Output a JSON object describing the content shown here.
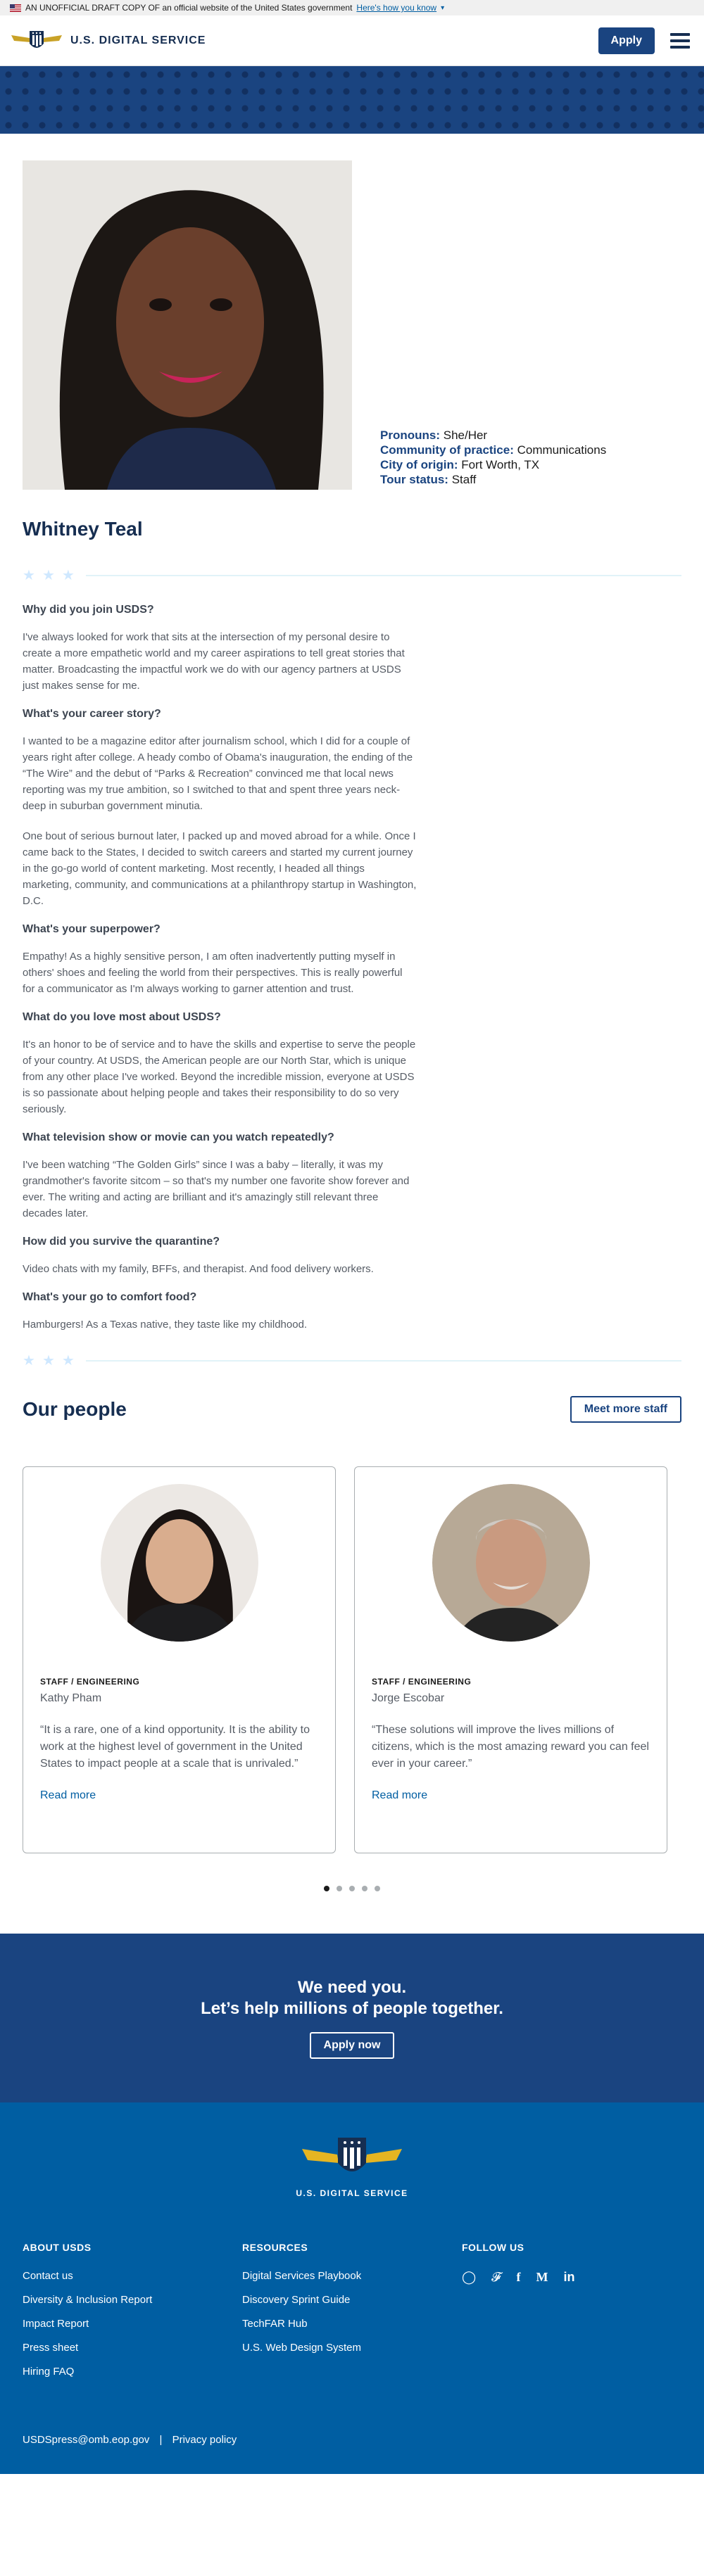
{
  "gov_banner": {
    "text": "AN UNOFFICIAL DRAFT COPY OF an official website of the United States government",
    "link": "Here's how you know"
  },
  "header": {
    "logo_text": "U.S. DIGITAL SERVICE",
    "apply_label": "Apply"
  },
  "profile": {
    "meta": [
      {
        "label": "Pronouns:",
        "value": "She/Her"
      },
      {
        "label": "Community of practice:",
        "value": "Communications"
      },
      {
        "label": "City of origin:",
        "value": "Fort Worth, TX"
      },
      {
        "label": "Tour status:",
        "value": "Staff"
      }
    ],
    "name": "Whitney Teal",
    "qa": [
      {
        "q": "Why did you join USDS?",
        "a": [
          "I've always looked for work that sits at the intersection of my personal desire to create a more empathetic world and my career aspirations to tell great stories that matter. Broadcasting the impactful work we do with our agency partners at USDS just makes sense for me."
        ]
      },
      {
        "q": "What's your career story?",
        "a": [
          "I wanted to be a magazine editor after journalism school, which I did for a couple of years right after college. A heady combo of Obama's inauguration, the ending of the “The Wire” and the debut of “Parks & Recreation” convinced me that local news reporting was my true ambition, so I switched to that and spent three years neck-deep in suburban government minutia.",
          "One bout of serious burnout later, I packed up and moved abroad for a while. Once I came back to the States, I decided to switch careers and started my current journey in the go-go world of content marketing. Most recently, I headed all things marketing, community, and communications at a philanthropy startup in Washington, D.C."
        ]
      },
      {
        "q": "What's your superpower?",
        "a": [
          "Empathy! As a highly sensitive person, I am often inadvertently putting myself in others' shoes and feeling the world from their perspectives. This is really powerful for a communicator as I'm always working to garner attention and trust."
        ]
      },
      {
        "q": "What do you love most about USDS?",
        "a": [
          "It's an honor to be of service and to have the skills and expertise to serve the people of your country. At USDS, the American people are our North Star, which is unique from any other place I've worked. Beyond the incredible mission, everyone at USDS is so passionate about helping people and takes their responsibility to do so very seriously."
        ]
      },
      {
        "q": "What television show or movie can you watch repeatedly?",
        "a": [
          "I've been watching “The Golden Girls” since I was a baby – literally, it was my grandmother's favorite sitcom – so that's my number one favorite show forever and ever. The writing and acting are brilliant and it's amazingly still relevant three decades later."
        ]
      },
      {
        "q": "How did you survive the quarantine?",
        "a": [
          "Video chats with my family, BFFs, and therapist. And food delivery workers."
        ]
      },
      {
        "q": "What's your go to comfort food?",
        "a": [
          "Hamburgers! As a Texas native, they taste like my childhood."
        ]
      }
    ]
  },
  "people": {
    "title": "Our people",
    "meet_label": "Meet more staff",
    "cards": [
      {
        "role": "STAFF / ENGINEERING",
        "name": "Kathy Pham",
        "quote": "“It is a rare, one of a kind opportunity. It is the ability to work at the highest level of government in the United States to impact people at a scale that is unrivaled.”",
        "link": "Read more"
      },
      {
        "role": "STAFF / ENGINEERING",
        "name": "Jorge Escobar",
        "quote": "“These solutions will improve the lives millions of citizens, which is the most amazing reward you can feel ever in your career.”",
        "link": "Read more"
      }
    ],
    "active_slide": 1,
    "slide_count": 5
  },
  "cta": {
    "line1": "We need you.",
    "line2": "Let’s help millions of people together.",
    "button": "Apply now"
  },
  "footer": {
    "logo_text": "U.S. DIGITAL SERVICE",
    "about_title": "ABOUT USDS",
    "about_links": [
      "Contact us",
      "Diversity & Inclusion Report",
      "Impact Report",
      "Press sheet",
      "Hiring FAQ"
    ],
    "resources_title": "RESOURCES",
    "resources_links": [
      "Digital Services Playbook",
      "Discovery Sprint Guide",
      "TechFAR Hub",
      "U.S. Web Design System"
    ],
    "follow_title": "FOLLOW US",
    "socials": [
      "instagram-icon",
      "twitter-icon",
      "facebook-icon",
      "medium-icon",
      "linkedin-icon"
    ],
    "email": "USDSpress@omb.eop.gov",
    "privacy": "Privacy policy"
  }
}
